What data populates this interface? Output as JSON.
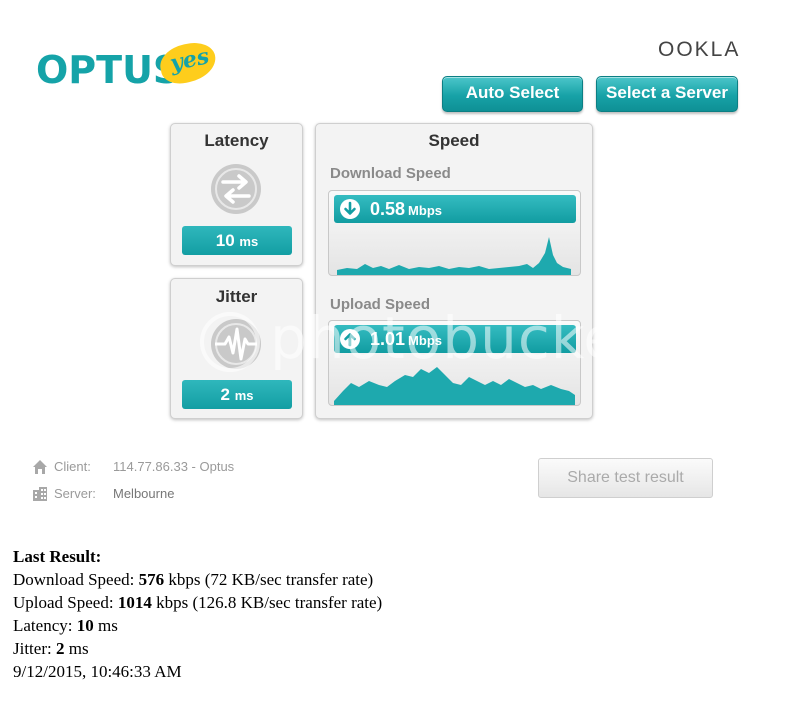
{
  "header": {
    "logo_text": "OPTUS",
    "logo_tagline": "yes",
    "ookla_text": "OOKLA",
    "auto_select_label": "Auto Select",
    "select_server_label": "Select a Server"
  },
  "latency": {
    "title": "Latency",
    "value": "10",
    "unit": "ms"
  },
  "jitter": {
    "title": "Jitter",
    "value": "2",
    "unit": "ms"
  },
  "speed": {
    "title": "Speed",
    "download": {
      "label": "Download Speed",
      "value": "0.58",
      "unit": "Mbps"
    },
    "upload": {
      "label": "Upload Speed",
      "value": "1.01",
      "unit": "Mbps"
    }
  },
  "info": {
    "client_label": "Client:",
    "client_value": "114.77.86.33 - Optus",
    "server_label": "Server:",
    "server_value": "Melbourne"
  },
  "share_button_label": "Share test result",
  "watermark_text": "photobucket",
  "last_result": {
    "heading": "Last Result:",
    "download_label": "Download Speed:",
    "download_value": "576",
    "download_detail": "kbps (72 KB/sec transfer rate)",
    "upload_label": "Upload Speed:",
    "upload_value": "1014",
    "upload_detail": "kbps (126.8 KB/sec transfer rate)",
    "latency_label": "Latency:",
    "latency_value": "10",
    "latency_unit": "ms",
    "jitter_label": "Jitter:",
    "jitter_value": "2",
    "jitter_unit": "ms",
    "timestamp": "9/12/2015, 10:46:33 AM"
  },
  "colors": {
    "accent": "#15a3a8",
    "yes_badge": "#fecd1c"
  }
}
